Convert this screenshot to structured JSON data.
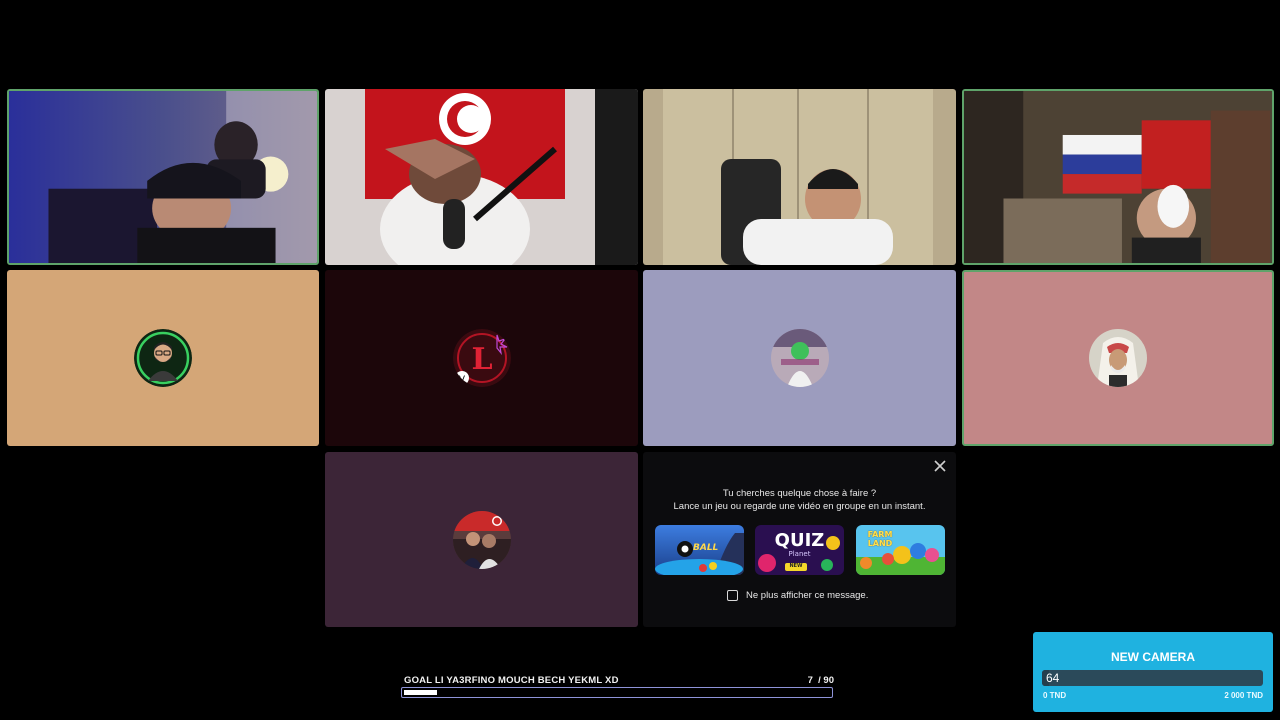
{
  "participants": [
    {
      "type": "video",
      "name_icon": "webcam-feed",
      "speaking": true
    },
    {
      "type": "video",
      "name_icon": "webcam-feed",
      "speaking": false
    },
    {
      "type": "video",
      "name_icon": "webcam-feed",
      "speaking": false
    },
    {
      "type": "video",
      "name_icon": "webcam-feed",
      "speaking": true
    },
    {
      "type": "avatar",
      "bg": "#d4a677",
      "speaking": false
    },
    {
      "type": "avatar",
      "bg": "#1c060a",
      "speaking": false
    },
    {
      "type": "avatar",
      "bg": "#9c9cbe",
      "speaking": false
    },
    {
      "type": "avatar",
      "bg": "#c28787",
      "speaking": true
    },
    {
      "type": "avatar",
      "bg": "#3c2537",
      "speaking": false
    }
  ],
  "activity_popup": {
    "line1": "Tu cherches quelque chose à faire ?",
    "line2": "Lance un jeu ou regarde une vidéo en groupe en un instant.",
    "games": [
      {
        "label": "BALL",
        "icon": "8-ball-pool-icon"
      },
      {
        "label": "QUIZ",
        "sub": "Planet",
        "tag": "NEW",
        "icon": "quiz-planet-icon"
      },
      {
        "label": "FARM LAND",
        "icon": "farm-land-icon"
      }
    ],
    "dont_show_label": "Ne plus afficher ce message.",
    "dont_show_checked": false,
    "close_icon": "close-icon"
  },
  "goal": {
    "title": "GOAL LI YA3RFINO MOUCH BECH YEKML XD",
    "count_text": "7  / 90",
    "current": 7,
    "target": 90
  },
  "camera_widget": {
    "title": "NEW CAMERA",
    "value": "64",
    "min_label": "0 TND",
    "max_label": "2 000 TND",
    "progress": 0.032
  },
  "colors": {
    "speaking_border": "#5fa36a",
    "goal_border": "#8e93d8",
    "camera_bg": "#1fb2e0"
  }
}
